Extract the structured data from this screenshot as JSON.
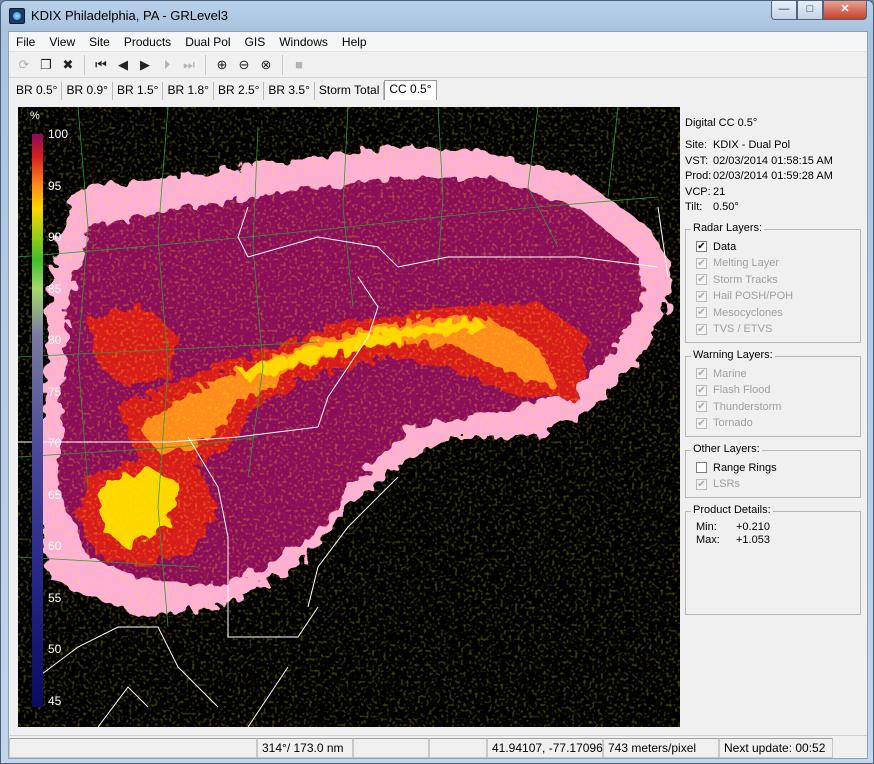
{
  "window": {
    "title": "KDIX Philadelphia, PA - GRLevel3"
  },
  "menu": [
    "File",
    "View",
    "Site",
    "Products",
    "Dual Pol",
    "GIS",
    "Windows",
    "Help"
  ],
  "toolbar": [
    {
      "name": "reload-icon",
      "glyph": "⟳",
      "enabled": false
    },
    {
      "name": "copy-icon",
      "glyph": "❐",
      "enabled": true
    },
    {
      "name": "delete-icon",
      "glyph": "✖",
      "enabled": true
    },
    {
      "name": "first-frame-icon",
      "glyph": "⏮",
      "enabled": true
    },
    {
      "name": "step-back-icon",
      "glyph": "◀",
      "enabled": true
    },
    {
      "name": "play-icon",
      "glyph": "▶",
      "enabled": true
    },
    {
      "name": "step-forward-icon",
      "glyph": "⏵",
      "enabled": false
    },
    {
      "name": "last-frame-icon",
      "glyph": "⏭",
      "enabled": false
    },
    {
      "name": "zoom-in-icon",
      "glyph": "⊕",
      "enabled": true
    },
    {
      "name": "zoom-out-icon",
      "glyph": "⊖",
      "enabled": true
    },
    {
      "name": "zoom-reset-icon",
      "glyph": "⊗",
      "enabled": true
    },
    {
      "name": "stop-icon",
      "glyph": "■",
      "enabled": false
    }
  ],
  "tabs": [
    "BR 0.5°",
    "BR 0.9°",
    "BR 1.5°",
    "BR 1.8°",
    "BR 2.5°",
    "BR 3.5°",
    "Storm Total",
    "CC 0.5°"
  ],
  "active_tab": "CC 0.5°",
  "legend": {
    "unit": "%",
    "ticks": [
      "100",
      "95",
      "90",
      "85",
      "80",
      "75",
      "70",
      "65",
      "60",
      "55",
      "50",
      "45"
    ]
  },
  "panel": {
    "product": "Digital CC 0.5°",
    "info": [
      {
        "label": "Site:",
        "value": "KDIX - Dual Pol"
      },
      {
        "label": "VST:",
        "value": "02/03/2014  01:58:15 AM"
      },
      {
        "label": "Prod:",
        "value": "02/03/2014  01:59:28 AM"
      },
      {
        "label": "VCP:",
        "value": "21"
      },
      {
        "label": "Tilt:",
        "value": "0.50°"
      }
    ],
    "radar_layers": {
      "title": "Radar Layers:",
      "items": [
        {
          "label": "Data",
          "checked": true,
          "enabled": true
        },
        {
          "label": "Melting Layer",
          "checked": true,
          "enabled": false
        },
        {
          "label": "Storm Tracks",
          "checked": true,
          "enabled": false
        },
        {
          "label": "Hail POSH/POH",
          "checked": true,
          "enabled": false
        },
        {
          "label": "Mesocyclones",
          "checked": true,
          "enabled": false
        },
        {
          "label": "TVS / ETVS",
          "checked": true,
          "enabled": false
        }
      ]
    },
    "warning_layers": {
      "title": "Warning Layers:",
      "items": [
        {
          "label": "Marine",
          "checked": true,
          "enabled": false
        },
        {
          "label": "Flash Flood",
          "checked": true,
          "enabled": false
        },
        {
          "label": "Thunderstorm",
          "checked": true,
          "enabled": false
        },
        {
          "label": "Tornado",
          "checked": true,
          "enabled": false
        }
      ]
    },
    "other_layers": {
      "title": "Other Layers:",
      "items": [
        {
          "label": "Range Rings",
          "checked": false,
          "enabled": true
        },
        {
          "label": "LSRs",
          "checked": true,
          "enabled": false
        }
      ]
    },
    "details": {
      "title": "Product Details:",
      "min_label": "Min:",
      "min": "+0.210",
      "max_label": "Max:",
      "max": "+1.053"
    }
  },
  "status": {
    "cell1": "",
    "azimuth_range": "314°/ 173.0 nm",
    "cell3": "",
    "cell4": "",
    "coords": "41.94107, -77.17096",
    "scale": "743 meters/pixel",
    "next_update": "Next update: 00:52"
  },
  "colors": {
    "cc_high": "#8c0a5a",
    "cc_mixed": "#ffb0d8",
    "cc_red": "#d81e1e",
    "cc_yellow": "#ffd700",
    "borders": "#2e7d32"
  }
}
